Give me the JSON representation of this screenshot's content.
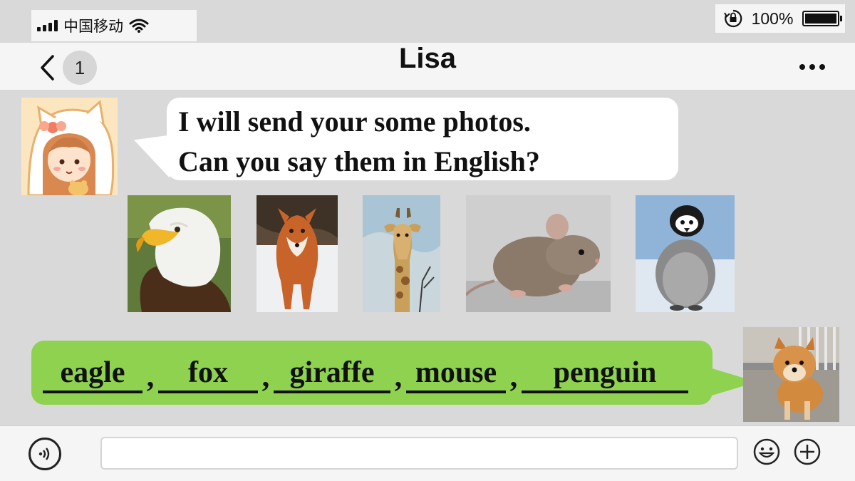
{
  "status_bar": {
    "carrier": "中国移动",
    "battery": "100%",
    "battery_level": 1.0
  },
  "nav": {
    "unread_count": "1",
    "title": "Lisa"
  },
  "messages": {
    "incoming": {
      "line1": "I will send your some photos.",
      "line2": "Can you say them in English?"
    },
    "photos": [
      "eagle-photo",
      "fox-photo",
      "giraffe-photo",
      "mouse-photo",
      "penguin-photo"
    ],
    "reply": {
      "answers": [
        "eagle",
        "fox",
        "giraffe",
        "mouse",
        "penguin"
      ],
      "separator": ","
    }
  },
  "input_bar": {
    "text_value": ""
  },
  "colors": {
    "reply_bubble": "#8fd24f",
    "chat_background": "#d9d9d9",
    "bar_background": "#f5f5f5"
  }
}
